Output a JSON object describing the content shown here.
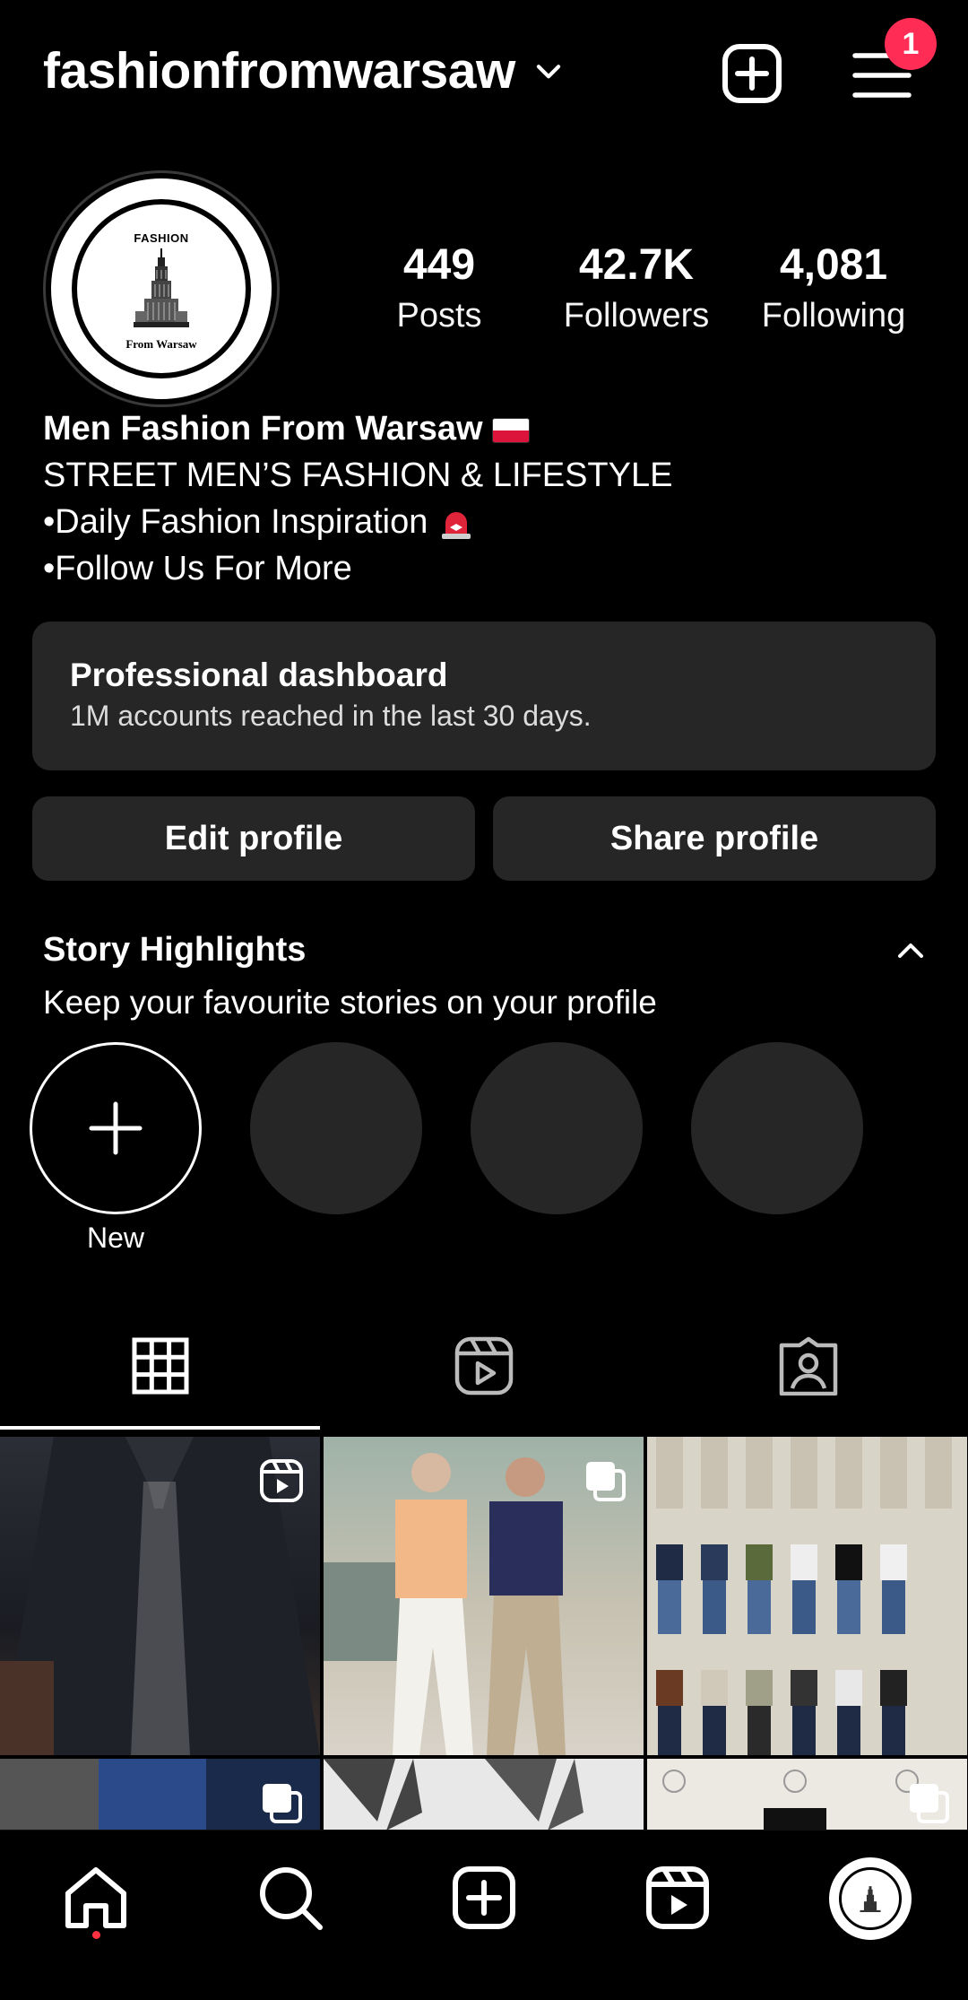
{
  "header": {
    "username": "fashionfromwarsaw",
    "notification_count": "1"
  },
  "profile": {
    "avatar_logo_top": "FASHION",
    "avatar_logo_bottom": "From Warsaw",
    "stats": [
      {
        "value": "449",
        "label": "Posts"
      },
      {
        "value": "42.7K",
        "label": "Followers"
      },
      {
        "value": "4,081",
        "label": "Following"
      }
    ],
    "bio": {
      "name": "Men Fashion From Warsaw",
      "line1": "STREET MEN’S FASHION & LIFESTYLE",
      "line2": "•Daily Fashion Inspiration",
      "line3": "•Follow Us For More"
    }
  },
  "dashboard": {
    "title": "Professional dashboard",
    "subtitle": "1M accounts reached in the last 30 days."
  },
  "actions": {
    "edit": "Edit profile",
    "share": "Share profile"
  },
  "highlights": {
    "title": "Story Highlights",
    "subtitle": "Keep your favourite stories on your profile",
    "new_label": "New"
  },
  "tabs": [
    "grid-icon",
    "reels-icon",
    "tagged-icon"
  ],
  "bottom_nav": [
    "home-icon",
    "search-icon",
    "create-icon",
    "reels-icon",
    "profile-avatar"
  ],
  "colors": {
    "background": "#000000",
    "surface": "#262626",
    "badge": "#ff2d55"
  }
}
